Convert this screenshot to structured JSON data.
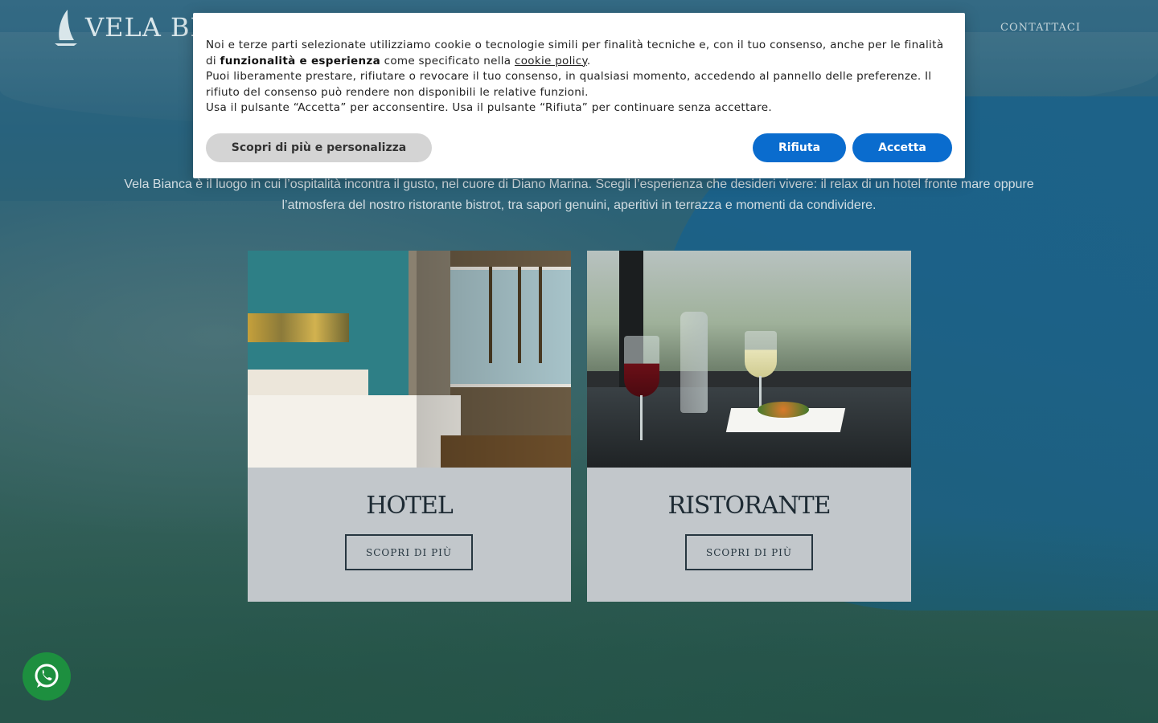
{
  "header": {
    "logo_text": "VELA BIA",
    "nav_contact": "CONTATTACI"
  },
  "intro": {
    "line1": "Vela Bianca è il luogo in cui l’ospitalità incontra il gusto, nel cuore di Diano Marina. Scegli l’esperienza che desideri vivere: il relax di un hotel fronte mare oppure",
    "line2": "l’atmosfera del nostro ristorante bistrot, tra sapori genuini, aperitivi in terrazza e momenti da condividere."
  },
  "cards": [
    {
      "title": "HOTEL",
      "button": "SCOPRI DI PIÙ"
    },
    {
      "title": "RISTORANTE",
      "button": "SCOPRI DI PIÙ"
    }
  ],
  "cookie": {
    "p1_a": "Noi e terze parti selezionate utilizziamo cookie o tecnologie simili per finalità tecniche e, con il tuo consenso, anche per le finalità di",
    "p1_bold": "funzionalità e esperienza",
    "p1_b": " come specificato nella ",
    "p1_link": "cookie policy",
    "p1_end": ".",
    "p2": "Puoi liberamente prestare, rifiutare o revocare il tuo consenso, in qualsiasi momento, accedendo al pannello delle preferenze. Il rifiuto del consenso può rendere non disponibili le relative funzioni.",
    "p3": "Usa il pulsante “Accetta” per acconsentire. Usa il pulsante “Rifiuta” per continuare senza accettare.",
    "btn_personalize": "Scopri di più e personalizza",
    "btn_reject": "Rifiuta",
    "btn_accept": "Accetta"
  },
  "whatsapp": {
    "icon": "whatsapp-icon"
  },
  "colors": {
    "accent": "#0a6cce",
    "whatsapp": "#1d8f3f"
  }
}
